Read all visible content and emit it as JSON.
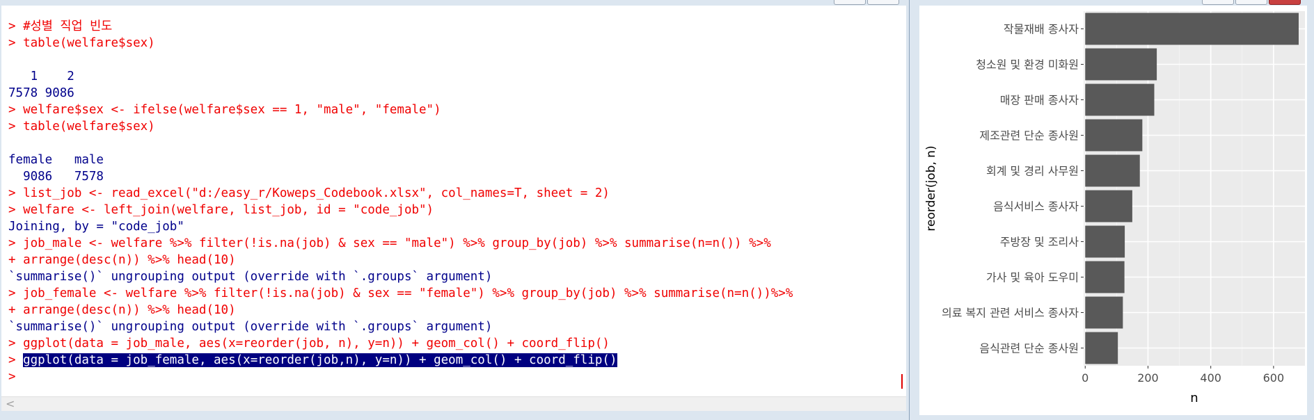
{
  "console": {
    "lines": [
      {
        "type": "cmd",
        "text": "> #성별 직업 빈도"
      },
      {
        "type": "cmd",
        "text": "> table(welfare$sex)"
      },
      {
        "type": "blank",
        "text": ""
      },
      {
        "type": "out",
        "text": "   1    2"
      },
      {
        "type": "out",
        "text": "7578 9086"
      },
      {
        "type": "cmd",
        "text": "> welfare$sex <- ifelse(welfare$sex == 1, \"male\", \"female\")"
      },
      {
        "type": "cmd",
        "text": "> table(welfare$sex)"
      },
      {
        "type": "blank",
        "text": ""
      },
      {
        "type": "out",
        "text": "female   male"
      },
      {
        "type": "out",
        "text": "  9086   7578"
      },
      {
        "type": "cmd",
        "text": "> list_job <- read_excel(\"d:/easy_r/Koweps_Codebook.xlsx\", col_names=T, sheet = 2)"
      },
      {
        "type": "cmd",
        "text": "> welfare <- left_join(welfare, list_job, id = \"code_job\")"
      },
      {
        "type": "out",
        "text": "Joining, by = \"code_job\""
      },
      {
        "type": "cmd",
        "text": "> job_male <- welfare %>% filter(!is.na(job) & sex == \"male\") %>% group_by(job) %>% summarise(n=n()) %>%"
      },
      {
        "type": "cmd",
        "text": "+ arrange(desc(n)) %>% head(10)"
      },
      {
        "type": "out",
        "text": "`summarise()` ungrouping output (override with `.groups` argument)"
      },
      {
        "type": "cmd",
        "text": "> job_female <- welfare %>% filter(!is.na(job) & sex == \"female\") %>% group_by(job) %>% summarise(n=n())%>%"
      },
      {
        "type": "cmd",
        "text": "+ arrange(desc(n)) %>% head(10)"
      },
      {
        "type": "out",
        "text": "`summarise()` ungrouping output (override with `.groups` argument)"
      },
      {
        "type": "cmd",
        "text": "> ggplot(data = job_male, aes(x=reorder(job, n), y=n)) + geom_col() + coord_flip()"
      },
      {
        "type": "sel",
        "prompt": "> ",
        "text": "ggplot(data = job_female, aes(x=reorder(job,n), y=n)) + geom_col() + coord_flip()"
      },
      {
        "type": "cmd",
        "text": ">"
      }
    ],
    "scroll_left_glyph": "<"
  },
  "colors": {
    "command": "#f00000",
    "output": "#00008b",
    "selection": "#000080",
    "bar": "#595959",
    "panel": "#ebebeb"
  },
  "chart_data": {
    "type": "bar",
    "orientation": "horizontal",
    "categories": [
      "작물재배 종사자",
      "청소원 및 환경 미화원",
      "매장 판매 종사자",
      "제조관련 단순 종사원",
      "회계 및 경리 사무원",
      "음식서비스 종사자",
      "주방장 및 조리사",
      "가사 및 육아 도우미",
      "의료 복지 관련 서비스 종사자",
      "음식관련 단순 종사원"
    ],
    "values": [
      680,
      228,
      220,
      182,
      174,
      150,
      126,
      125,
      120,
      104
    ],
    "xlabel": "n",
    "ylabel": "reorder(job, n)",
    "xlim": [
      -5,
      700
    ],
    "xticks": [
      0,
      200,
      400,
      600
    ],
    "grid": true
  }
}
